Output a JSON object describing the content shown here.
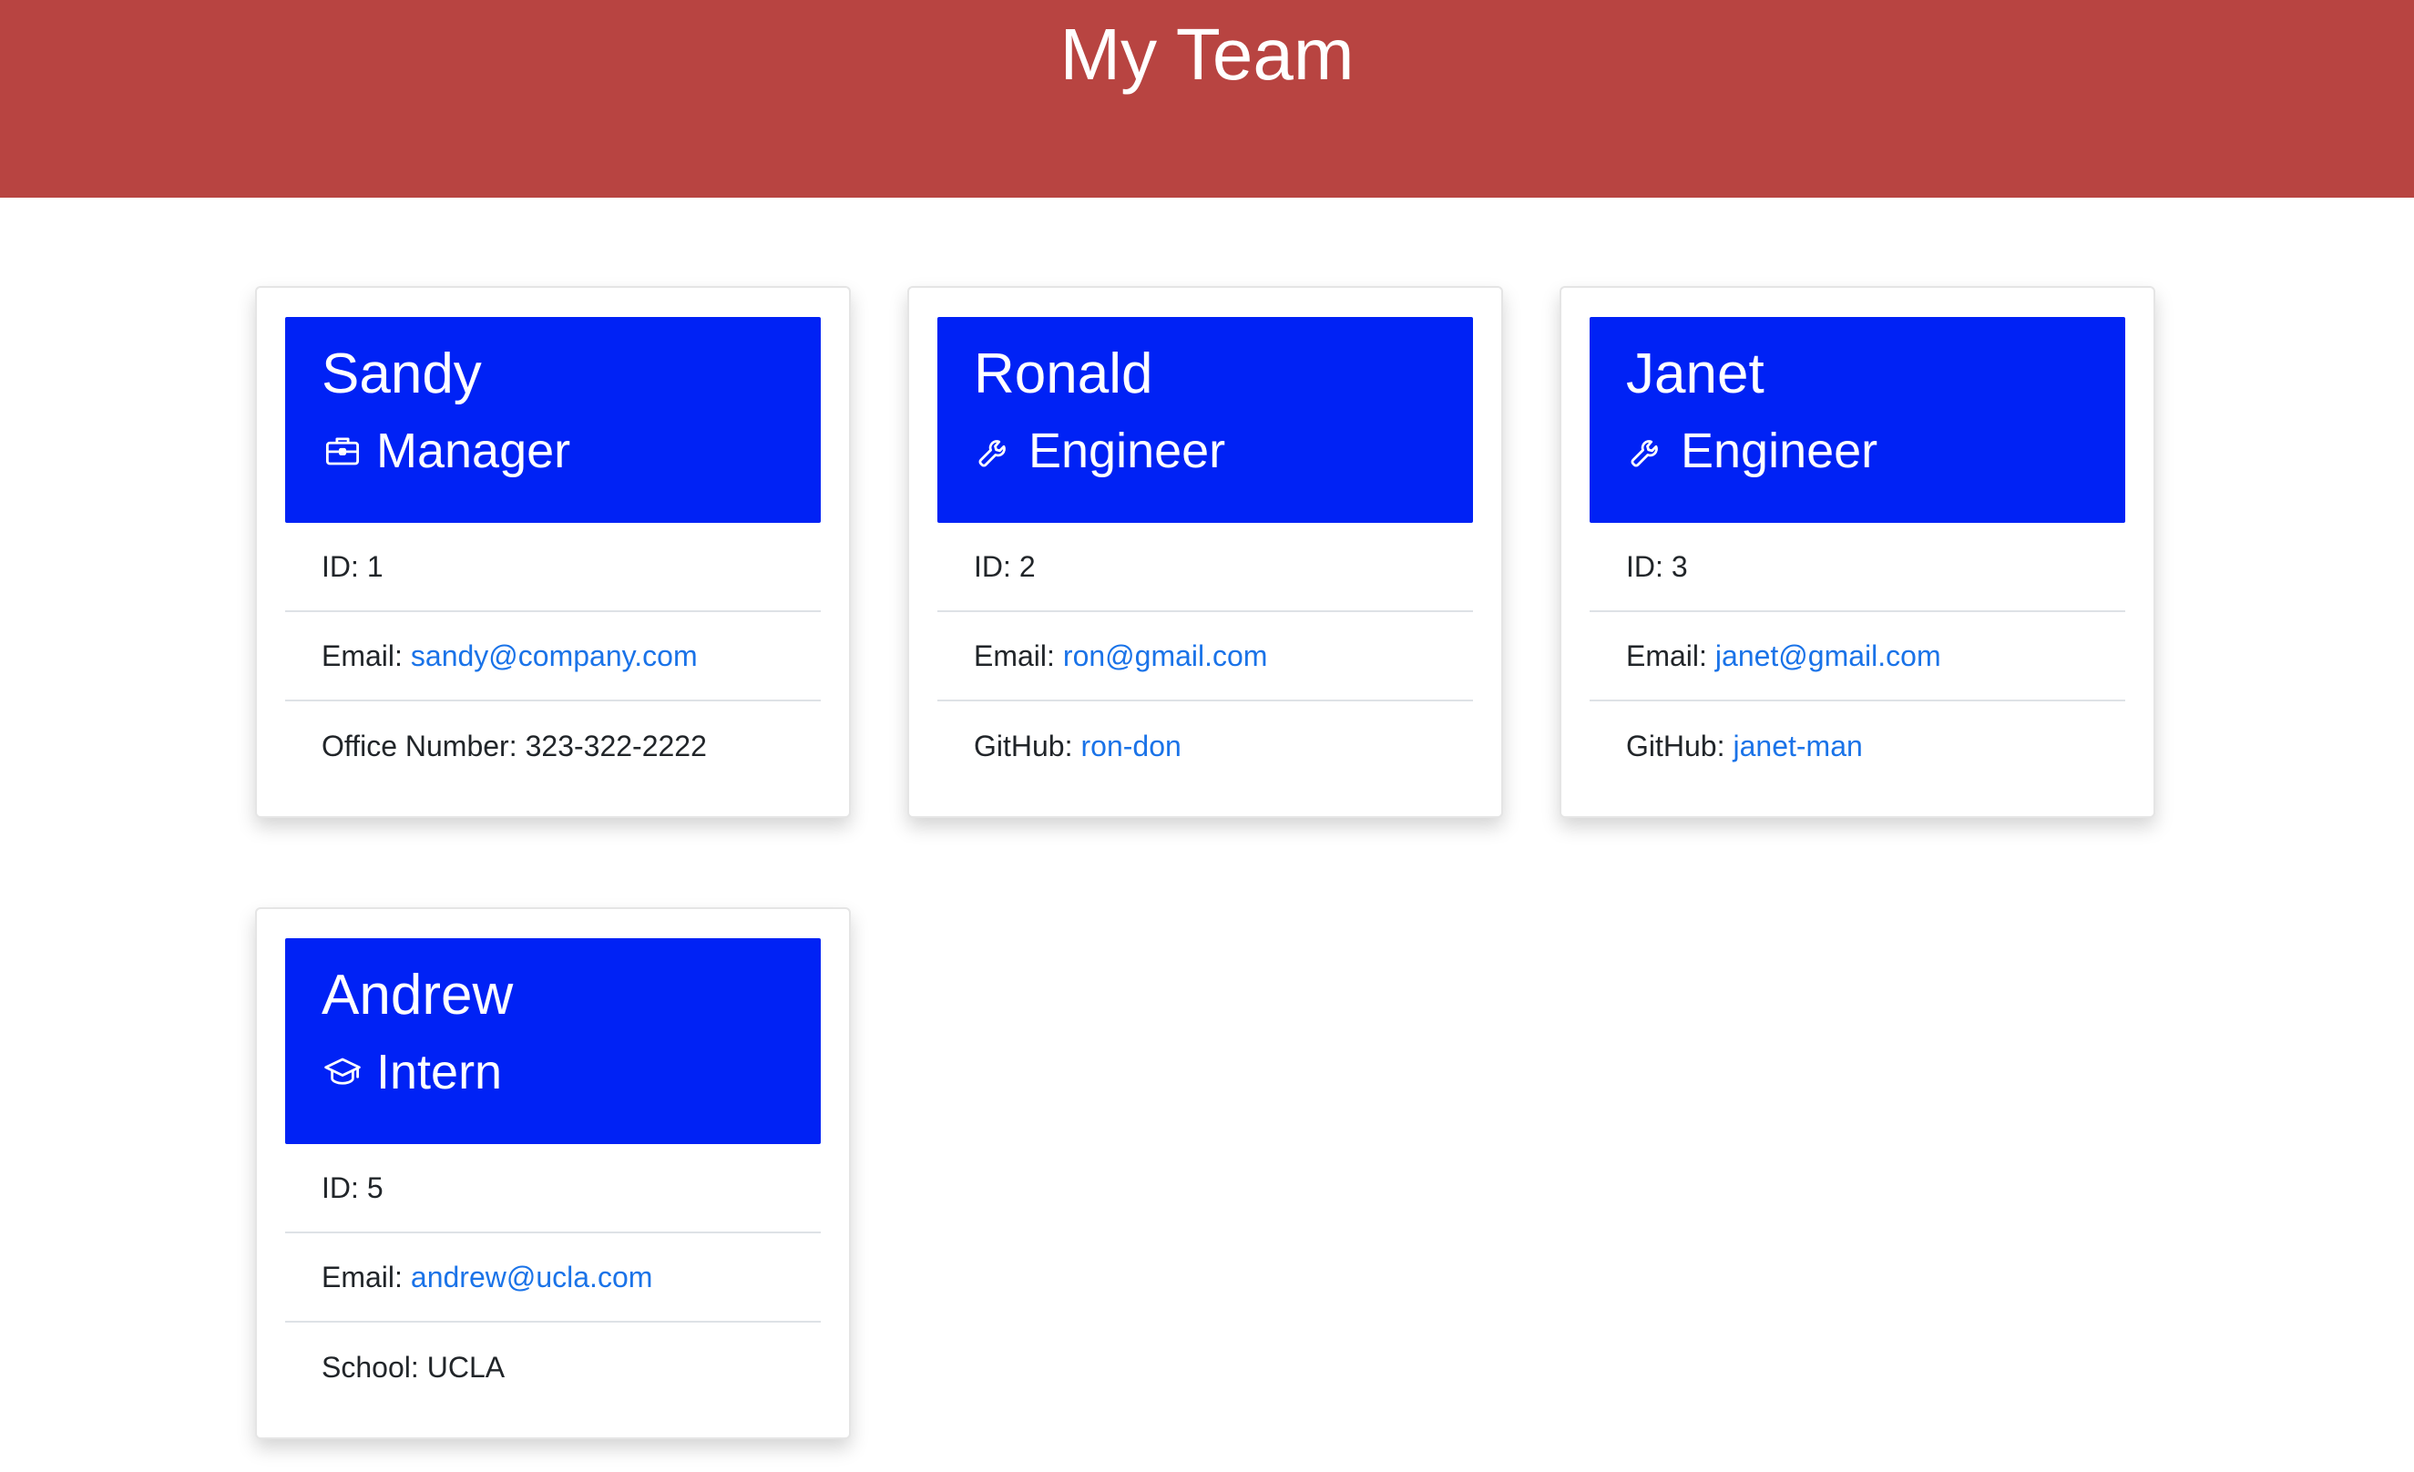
{
  "page": {
    "title": "My Team"
  },
  "colors": {
    "header_bg": "#b84441",
    "card_header_bg": "#0022f5",
    "link": "#1a73e8"
  },
  "employees": [
    {
      "name": "Sandy",
      "role": "Manager",
      "role_icon": "briefcase-icon",
      "id_label": "ID:",
      "id": "1",
      "email_label": "Email:",
      "email": "sandy@company.com",
      "extra_label": "Office Number:",
      "extra_value": "323-322-2222"
    },
    {
      "name": "Ronald",
      "role": "Engineer",
      "role_icon": "wrench-icon",
      "id_label": "ID:",
      "id": "2",
      "email_label": "Email:",
      "email": "ron@gmail.com",
      "extra_label": "GitHub:",
      "extra_value": "ron-don"
    },
    {
      "name": "Janet",
      "role": "Engineer",
      "role_icon": "wrench-icon",
      "id_label": "ID:",
      "id": "3",
      "email_label": "Email:",
      "email": "janet@gmail.com",
      "extra_label": "GitHub:",
      "extra_value": "janet-man"
    },
    {
      "name": "Andrew",
      "role": "Intern",
      "role_icon": "graduation-cap-icon",
      "id_label": "ID:",
      "id": "5",
      "email_label": "Email:",
      "email": "andrew@ucla.com",
      "extra_label": "School:",
      "extra_value": "UCLA"
    }
  ]
}
